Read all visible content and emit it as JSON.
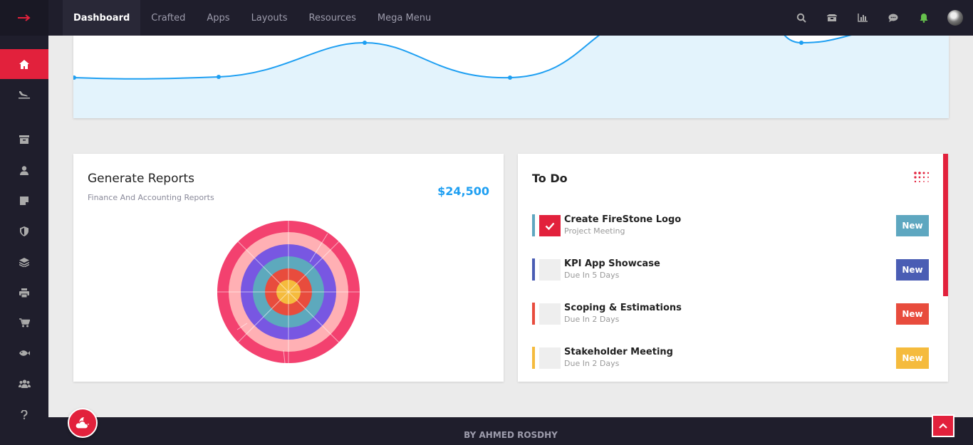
{
  "nav": {
    "items": [
      "Dashboard",
      "Crafted",
      "Apps",
      "Layouts",
      "Resources",
      "Mega Menu"
    ]
  },
  "top_icons": [
    "search-icon",
    "archive-box-icon",
    "bar-chart-icon",
    "chat-icon",
    "bell-icon",
    "user-avatar"
  ],
  "sidebar": {
    "icons": [
      "home-icon",
      "plane-landing-icon",
      "archive-icon",
      "user-icon",
      "note-icon",
      "shield-icon",
      "layers-icon",
      "printer-icon",
      "cart-icon",
      "fish-icon",
      "users-icon",
      "question-icon"
    ]
  },
  "reports": {
    "title": "Generate Reports",
    "subtitle": "Finance And Accounting Reports",
    "amount": "$24,500"
  },
  "todo": {
    "title": "To Do",
    "items": [
      {
        "name": "Create FireStone Logo",
        "meta": "Project Meeting",
        "badge": "New",
        "color": "#5ea7c0",
        "done": true
      },
      {
        "name": "KPI App Showcase",
        "meta": "Due In 5 Days",
        "badge": "New",
        "color": "#4a5db4",
        "done": false
      },
      {
        "name": "Scoping & Estimations",
        "meta": "Due In 2 Days",
        "badge": "New",
        "color": "#e84c3d",
        "done": false
      },
      {
        "name": "Stakeholder Meeting",
        "meta": "Due In 2 Days",
        "badge": "New",
        "color": "#f5bb3d",
        "done": false
      }
    ]
  },
  "footer": {
    "text": "BY AHMED ROSDHY"
  },
  "colors": {
    "accent": "#e2213c",
    "blue": "#1e9ff2",
    "dark": "#1f1e2c"
  }
}
